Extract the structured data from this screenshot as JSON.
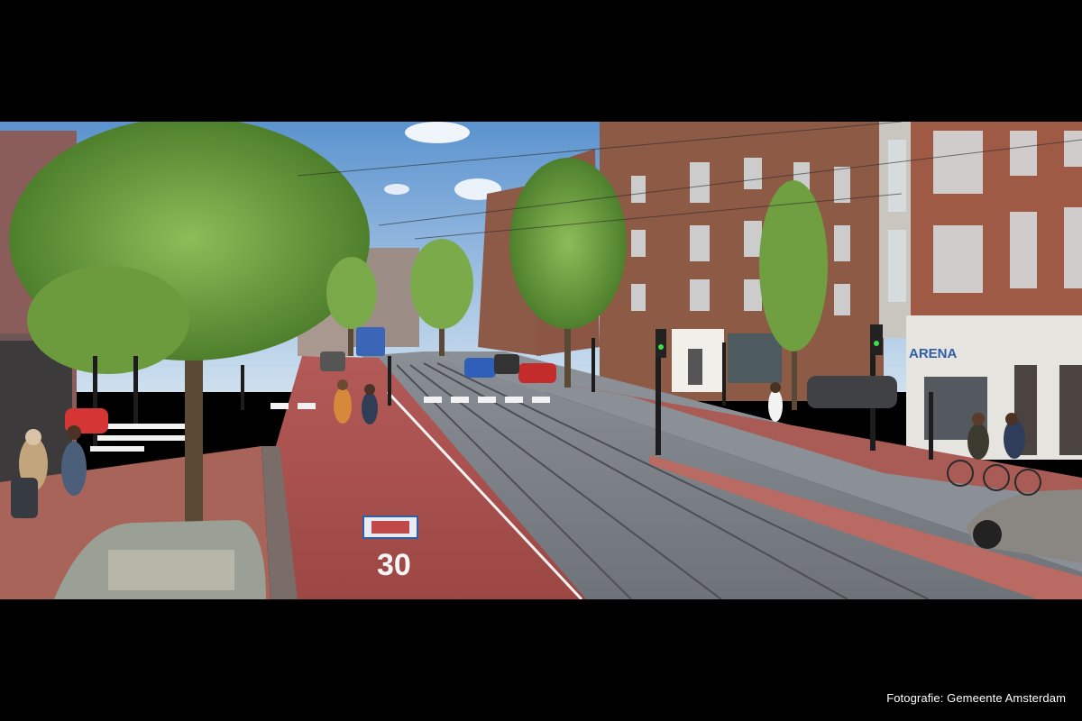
{
  "photo": {
    "road_marking": "30",
    "shop_sign": "ARENA"
  },
  "caption": {
    "credit": "Fotografie: Gemeente Amsterdam"
  }
}
